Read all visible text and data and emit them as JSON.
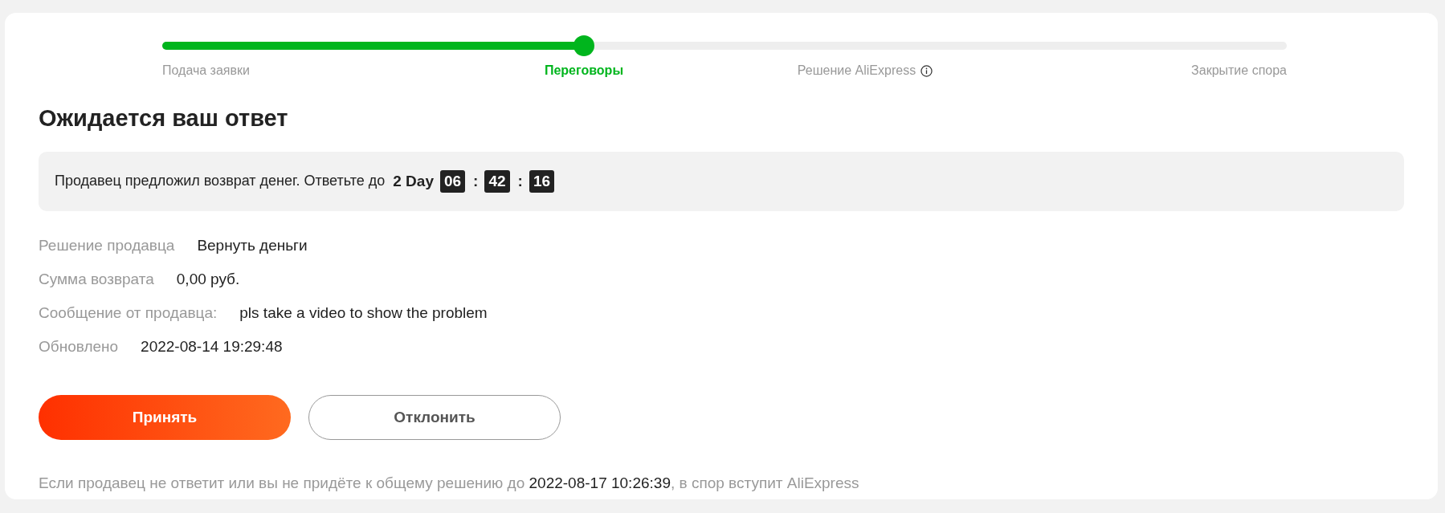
{
  "progress": {
    "level": 0.375,
    "steps": [
      {
        "label": "Подача заявки",
        "selected": false,
        "info": false
      },
      {
        "label": "Переговоры",
        "selected": true,
        "info": false
      },
      {
        "label": "Решение AliExpress",
        "selected": false,
        "info": true
      },
      {
        "label": "Закрытие спора",
        "selected": false,
        "info": false
      }
    ]
  },
  "heading": "Ожидается ваш ответ",
  "notice": {
    "text": "Продавец предложил возврат денег. Ответьте до",
    "countdown": [
      {
        "kind": "days",
        "text": "2 Day"
      },
      {
        "kind": "box",
        "text": "06"
      },
      {
        "kind": "sep",
        "text": ":"
      },
      {
        "kind": "box",
        "text": "42"
      },
      {
        "kind": "sep",
        "text": ":"
      },
      {
        "kind": "box",
        "text": "16"
      }
    ]
  },
  "details": [
    {
      "label": "Решение продавца",
      "value": "Вернуть деньги"
    },
    {
      "label": "Сумма возврата",
      "value": "0,00 руб."
    },
    {
      "label": "Сообщение от продавца:",
      "value": "pls take a video to show the problem"
    },
    {
      "label": "Обновлено",
      "value": "2022-08-14 19:29:48"
    }
  ],
  "buttons": [
    {
      "label": "Принять",
      "kind": "primary"
    },
    {
      "label": "Отклонить",
      "kind": "outline"
    }
  ],
  "footer": {
    "before": "Если продавец не ответит или вы не придёте к общему решению до",
    "date": "2022-08-17 10:26:39",
    "after": ", в спор вступит AliExpress"
  }
}
